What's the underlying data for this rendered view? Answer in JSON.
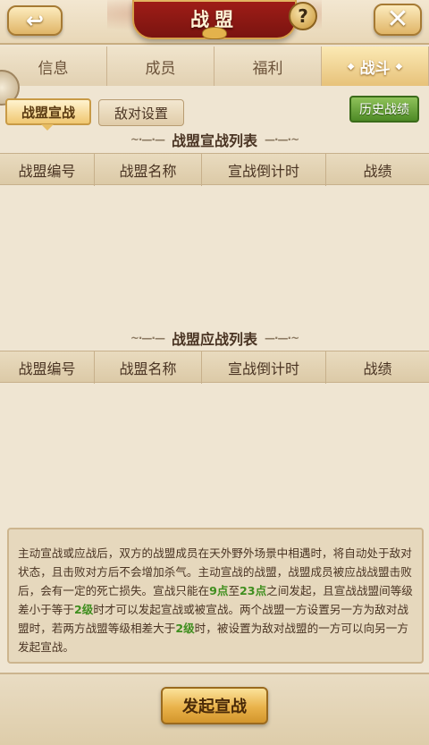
{
  "header": {
    "title": "战盟",
    "back_icon": "back-arrow-icon",
    "help_label": "?",
    "close_label": "✕"
  },
  "tabs": [
    {
      "label": "信息",
      "active": false
    },
    {
      "label": "成员",
      "active": false
    },
    {
      "label": "福利",
      "active": false
    },
    {
      "label": "战斗",
      "active": true
    }
  ],
  "subtabs": {
    "declare": "战盟宣战",
    "enemy_settings": "敌对设置",
    "history": "历史战绩"
  },
  "declare_list": {
    "title": "战盟宣战列表",
    "columns": [
      "战盟编号",
      "战盟名称",
      "宣战倒计时",
      "战绩"
    ],
    "rows": []
  },
  "response_list": {
    "title": "战盟应战列表",
    "columns": [
      "战盟编号",
      "战盟名称",
      "宣战倒计时",
      "战绩"
    ],
    "rows": []
  },
  "info": {
    "p1": "主动宣战或应战后，双方的战盟成员在天外野外场景中相遇时，将自动处于敌对状态，且击败对方后不会增加杀气。主动宣战的战盟，战盟成员被应战战盟击败后，会有一定的死亡损失。宣战只能在",
    "h1": "9点",
    "p2": "至",
    "h2": "23点",
    "p3": "之间发起，且宣战战盟间等级差小于等于",
    "h3": "2级",
    "p4": "时才可以发起宣战或被宣战。两个战盟一方设置另一方为敌对战盟时，若两方战盟等级相差大于",
    "h4": "2级",
    "p5": "时，被设置为敌对战盟的一方可以向另一方发起宣战。"
  },
  "footer": {
    "declare_button": "发起宣战"
  },
  "colors": {
    "accent_green": "#3f8e1e",
    "title_red": "#8e1812",
    "gold": "#e9b24a"
  }
}
